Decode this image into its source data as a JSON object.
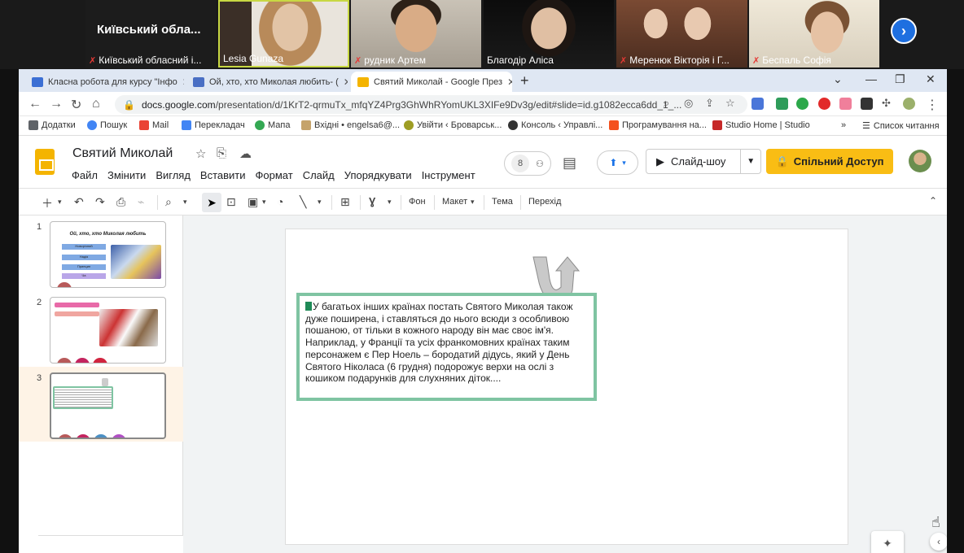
{
  "zoom": {
    "main_label": "Київський обла...",
    "participants": [
      {
        "name": "Київський обласний і...",
        "muted": true
      },
      {
        "name": "Lesia Gunaza",
        "muted": false
      },
      {
        "name": "рудник Артем",
        "muted": true
      },
      {
        "name": "Благодір Аліса",
        "muted": false
      },
      {
        "name": "Меренюк Вікторія і Г...",
        "muted": true
      },
      {
        "name": "Беспаль Софія",
        "muted": true
      }
    ],
    "next_icon": "chevron-right-icon"
  },
  "browser": {
    "tabs": [
      {
        "label": "Класна робота для курсу \"Інфо",
        "favicon_color": "#3b6fd4"
      },
      {
        "label": "Ой, хто, хто Миколая любить- (",
        "favicon_color": "#4a6fc4"
      },
      {
        "label": "Святий Миколай - Google През",
        "favicon_color": "#f4b400"
      }
    ],
    "url_prefix": "docs.google.com",
    "url_rest": "/presentation/d/1KrT2-qrmuTx_mfqYZ4Prg3GhWhRYomUKL3XIFe9Dv3g/edit#slide=id.g1082ecca6dd_1_...",
    "bookmarks": [
      {
        "label": "Додатки",
        "color": "#5f6368"
      },
      {
        "label": "Пошук",
        "color": "#4285f4"
      },
      {
        "label": "Mail",
        "color": "#ea4335"
      },
      {
        "label": "Перекладач",
        "color": "#4285f4"
      },
      {
        "label": "Мапа",
        "color": "#34a853"
      },
      {
        "label": "Вхідні • engelsa6@...",
        "color": "#c5a36b"
      },
      {
        "label": "Увійти ‹ Броварськ...",
        "color": "#9e9d24"
      },
      {
        "label": "Консоль ‹ Управлі...",
        "color": "#333333"
      },
      {
        "label": "Програмування на...",
        "color": "#f4511e"
      },
      {
        "label": "Studio Home | Studio",
        "color": "#c62828"
      }
    ],
    "reading_list": "Список читання"
  },
  "slides": {
    "doc_title": "Святий Миколай",
    "menu": [
      "Файл",
      "Змінити",
      "Вигляд",
      "Вставити",
      "Формат",
      "Слайд",
      "Упорядкувати",
      "Інструмент"
    ],
    "collab_count": "8",
    "slideshow_label": "Слайд-шоу",
    "share_label": "Спільний Доступ",
    "toolbar": {
      "background": "Фон",
      "layout": "Макет",
      "theme": "Тема",
      "transition": "Перехід"
    },
    "thumbnails": [
      {
        "num": "1",
        "title": "Ой, хто, хто Миколая любить",
        "buttons": [
          "Новорічний",
          "Надія",
          "Принцип",
          "Ча"
        ]
      },
      {
        "num": "2"
      },
      {
        "num": "3"
      }
    ],
    "slide_text": "У багатьох інших країнах постать Святого Миколая також дуже поширена, і ставляться до нього всюди з особливою пошаною, от тільки в кожного народу він має своє ім'я. Наприклад, у Франції та усіх франкомовних країнах таким персонажем є Пер Ноель – бородатий дідусь, який у День Святого Ніколаса (6 грудня) подорожує верхи на ослі з кошиком подарунків для слухняних діток...."
  },
  "colors": {
    "slides_accent": "#f4b400",
    "share_button": "#f9bd14",
    "textbox_border": "#7fc4a2",
    "zoom_blue": "#1e6fe0",
    "mute_red": "#e53935"
  }
}
